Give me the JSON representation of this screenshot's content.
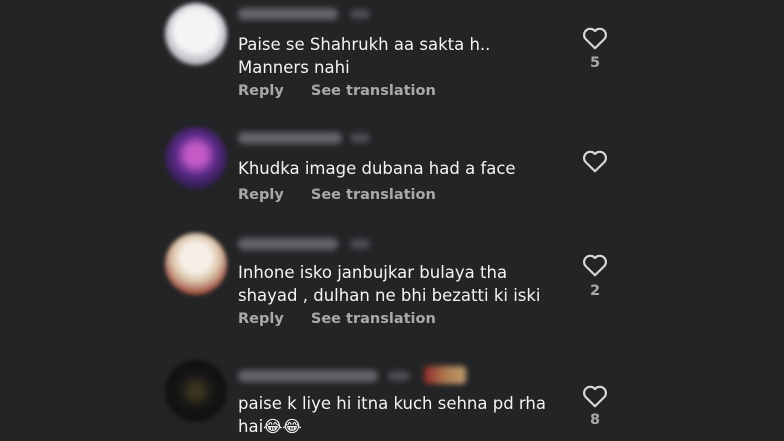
{
  "comments": [
    {
      "text": "Paise se Shahrukh aa sakta h..\nManners nahi",
      "reply": "Reply",
      "translate": "See translation",
      "likes": "5"
    },
    {
      "text": "Khudka image dubana had a face",
      "reply": "Reply",
      "translate": "See translation",
      "likes": ""
    },
    {
      "text": "Inhone isko janbujkar bulaya tha\nshayad , dulhan ne bhi bezatti ki iski",
      "reply": "Reply",
      "translate": "See translation",
      "likes": "2"
    },
    {
      "text": "paise k liye hi itna kuch sehna pd rha\nhai😂😂",
      "reply": "",
      "translate": "",
      "likes": "8"
    }
  ],
  "icons": {
    "like": "heart-outline-icon"
  },
  "colors": {
    "background": "#232426",
    "secondary_text": "#a8a9ab"
  }
}
